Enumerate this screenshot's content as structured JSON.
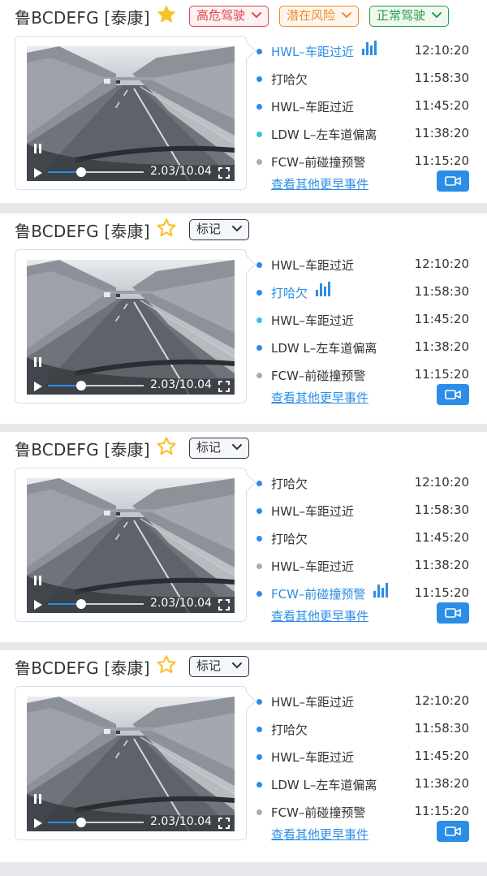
{
  "colors": {
    "accent": "#2b8de6",
    "danger": "#d9474c",
    "warning": "#ef8a2b",
    "normal": "#2d9a4c",
    "neutral": "#333333",
    "star": "#f8c32a",
    "dot_blue": "#2b8de6",
    "dot_cyan": "#3cc4d6",
    "dot_gray": "#a9adb3"
  },
  "cards": [
    {
      "plate": "鲁BCDEFG [泰康]",
      "starred": true,
      "tags": [
        {
          "label": "高危驾驶",
          "color": "#d9474c",
          "bg": "#fdf1f1"
        },
        {
          "label": "潜在风险",
          "color": "#ef8a2b",
          "bg": "#fef6ec"
        },
        {
          "label": "正常驾驶",
          "color": "#2d9a4c",
          "bg": "#eff9f0"
        }
      ],
      "video": {
        "time": "2.03/10.04",
        "progress": 0.35,
        "pause_icon": "pause-icon",
        "play_icon": "play-icon",
        "fullscreen_icon": "fullscreen-icon"
      },
      "events": [
        {
          "name": "HWL–车距过近",
          "time": "12:10:20",
          "dot": "blue",
          "active": true
        },
        {
          "name": "打哈欠",
          "time": "11:58:30",
          "dot": "blue",
          "active": false
        },
        {
          "name": "HWL–车距过近",
          "time": "11:45:20",
          "dot": "blue",
          "active": false
        },
        {
          "name": "LDW L–左车道偏离",
          "time": "11:38:20",
          "dot": "cyan",
          "active": false
        },
        {
          "name": "FCW–前碰撞预警",
          "time": "11:15:20",
          "dot": "gray",
          "active": false
        }
      ],
      "more_link": "查看其他更早事件",
      "record_icon": "video-camera-icon"
    },
    {
      "plate": "鲁BCDEFG [泰康]",
      "starred": false,
      "tags": [
        {
          "label": "标记",
          "color": "#333333",
          "bg": "#f3f6fa"
        }
      ],
      "video": {
        "time": "2.03/10.04",
        "progress": 0.35,
        "pause_icon": "pause-icon",
        "play_icon": "play-icon",
        "fullscreen_icon": "fullscreen-icon"
      },
      "events": [
        {
          "name": "HWL–车距过近",
          "time": "12:10:20",
          "dot": "blue",
          "active": false
        },
        {
          "name": "打哈欠",
          "time": "11:58:30",
          "dot": "blue",
          "active": true
        },
        {
          "name": "HWL–车距过近",
          "time": "11:45:20",
          "dot": "cyan",
          "active": false
        },
        {
          "name": "LDW L–左车道偏离",
          "time": "11:38:20",
          "dot": "blue",
          "active": false
        },
        {
          "name": "FCW–前碰撞预警",
          "time": "11:15:20",
          "dot": "gray",
          "active": false
        }
      ],
      "more_link": "查看其他更早事件",
      "record_icon": "video-camera-icon"
    },
    {
      "plate": "鲁BCDEFG [泰康]",
      "starred": false,
      "tags": [
        {
          "label": "标记",
          "color": "#333333",
          "bg": "#f3f6fa"
        }
      ],
      "video": {
        "time": "2.03/10.04",
        "progress": 0.35,
        "pause_icon": "pause-icon",
        "play_icon": "play-icon",
        "fullscreen_icon": "fullscreen-icon"
      },
      "events": [
        {
          "name": "打哈欠",
          "time": "12:10:20",
          "dot": "blue",
          "active": false
        },
        {
          "name": "HWL–车距过近",
          "time": "11:58:30",
          "dot": "blue",
          "active": false
        },
        {
          "name": "打哈欠",
          "time": "11:45:20",
          "dot": "blue",
          "active": false
        },
        {
          "name": "HWL–车距过近",
          "time": "11:38:20",
          "dot": "gray",
          "active": false
        },
        {
          "name": "FCW–前碰撞预警",
          "time": "11:15:20",
          "dot": "blue",
          "active": true
        }
      ],
      "more_link": "查看其他更早事件",
      "record_icon": "video-camera-icon"
    },
    {
      "plate": "鲁BCDEFG [泰康]",
      "starred": false,
      "tags": [
        {
          "label": "标记",
          "color": "#333333",
          "bg": "#f3f6fa"
        }
      ],
      "video": {
        "time": "2.03/10.04",
        "progress": 0.35,
        "pause_icon": "pause-icon",
        "play_icon": "play-icon",
        "fullscreen_icon": "fullscreen-icon"
      },
      "events": [
        {
          "name": "HWL–车距过近",
          "time": "12:10:20",
          "dot": "blue",
          "active": false
        },
        {
          "name": "打哈欠",
          "time": "11:58:30",
          "dot": "blue",
          "active": false
        },
        {
          "name": "HWL–车距过近",
          "time": "11:45:20",
          "dot": "blue",
          "active": false
        },
        {
          "name": "LDW L–左车道偏离",
          "time": "11:38:20",
          "dot": "blue",
          "active": false
        },
        {
          "name": "FCW–前碰撞预警",
          "time": "11:15:20",
          "dot": "gray",
          "active": false
        }
      ],
      "more_link": "查看其他更早事件",
      "record_icon": "video-camera-icon"
    }
  ]
}
